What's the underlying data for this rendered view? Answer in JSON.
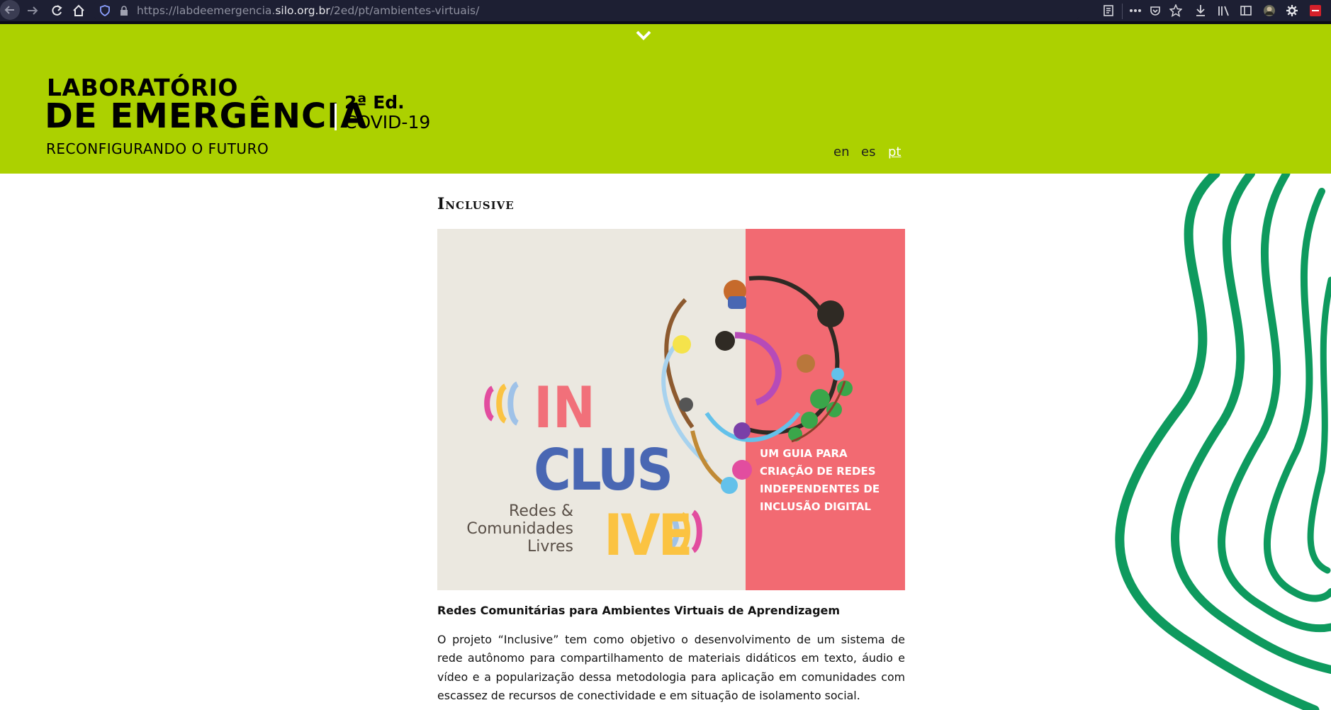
{
  "browser": {
    "url_prefix": "https://labdeemergencia.",
    "url_host": "silo.org.br",
    "url_path": "/2ed/pt/ambientes-virtuais/"
  },
  "site": {
    "logo": {
      "line1": "LABORATÓRIO",
      "line2": "DE EMERGÊNCIA",
      "edition": "2ª Ed.",
      "covid": "COVID-19",
      "tagline": "RECONFIGURANDO O FUTURO"
    },
    "languages": [
      {
        "label": "en",
        "active": false
      },
      {
        "label": "es",
        "active": false
      },
      {
        "label": "pt",
        "active": true
      }
    ],
    "colors": {
      "header_bg": "#acd100",
      "wave": "#0e9a5e"
    }
  },
  "page": {
    "title": "Inclusive",
    "hero": {
      "word_in": "IN",
      "word_clus": "CLUS",
      "word_ive": "IVE",
      "subtitle_line1": "Redes &",
      "subtitle_line2": "Comunidades",
      "subtitle_line3": "Livres",
      "guide_line1": "UM GUIA PARA",
      "guide_line2": "CRIAÇÃO DE REDES",
      "guide_line3": "INDEPENDENTES DE",
      "guide_line4": "INCLUSÃO DIGITAL",
      "colors": {
        "left_bg": "#ebe8e0",
        "right_bg": "#f26a72",
        "in": "#f1707a",
        "clus": "#4967b3",
        "ive": "#fbc342"
      }
    },
    "subtitle": "Redes Comunitárias para Ambientes Virtuais de Aprendizagem",
    "paragraph": "O projeto “Inclusive” tem como objetivo o desenvolvimento de um sistema de rede autônomo para compartilhamento de materiais didáticos em texto, áudio e vídeo e a popularização dessa metodologia para aplicação em comunidades com escassez de recursos de conectividade e em situação de isolamento social."
  }
}
